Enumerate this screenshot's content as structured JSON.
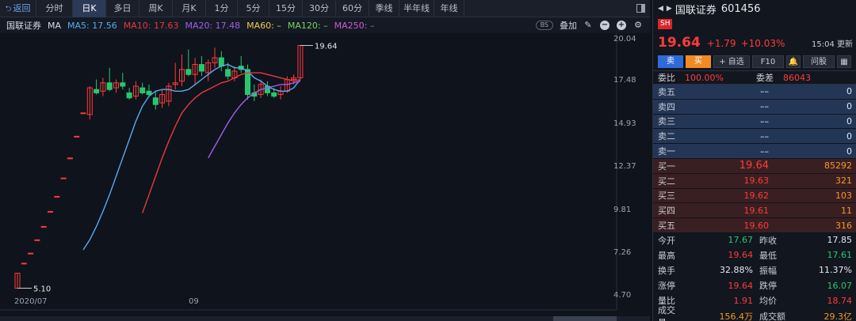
{
  "tabs": {
    "back": "返回",
    "items": [
      "分时",
      "日K",
      "多日",
      "周K",
      "月K",
      "1分",
      "5分",
      "15分",
      "30分",
      "60分",
      "季线",
      "半年线",
      "年线"
    ],
    "active": "日K"
  },
  "header": {
    "stock_name": "国联证券",
    "ma_label": "MA",
    "ma5": "MA5: 17.56",
    "ma10": "MA10: 17.63",
    "ma20": "MA20: 17.48",
    "ma60": "MA60: –",
    "ma120": "MA120: –",
    "ma250": "MA250: –",
    "bs": "BS",
    "overlay": "叠加"
  },
  "colors": {
    "up": "#ff3b3b",
    "down": "#28c76f",
    "ma5": "#5aa9f0",
    "ma10": "#e8393c",
    "ma20": "#a45ee8",
    "ma60": "#f2c94c",
    "ma120": "#7bd35a",
    "ma250": "#d05ad0"
  },
  "chart_data": {
    "type": "candlestick",
    "ylim": [
      4.7,
      20.04
    ],
    "y_ticks": [
      "20.04",
      "17.48",
      "14.93",
      "12.37",
      "9.81",
      "7.26",
      "4.70"
    ],
    "x_labels": [
      "2020/07",
      "09"
    ],
    "high_label": "19.64",
    "low_label": "5.10",
    "candles": [
      {
        "o": 5.1,
        "h": 6.0,
        "l": 5.1,
        "c": 6.0
      },
      {
        "o": 6.6,
        "h": 6.6,
        "l": 6.6,
        "c": 6.6
      },
      {
        "o": 7.2,
        "h": 7.2,
        "l": 7.2,
        "c": 7.2
      },
      {
        "o": 8.0,
        "h": 8.0,
        "l": 8.0,
        "c": 8.0
      },
      {
        "o": 8.8,
        "h": 8.8,
        "l": 8.8,
        "c": 8.8
      },
      {
        "o": 9.7,
        "h": 9.7,
        "l": 9.7,
        "c": 9.7
      },
      {
        "o": 10.6,
        "h": 10.6,
        "l": 10.6,
        "c": 10.6
      },
      {
        "o": 11.7,
        "h": 11.7,
        "l": 11.7,
        "c": 11.7
      },
      {
        "o": 12.9,
        "h": 12.9,
        "l": 12.9,
        "c": 12.9
      },
      {
        "o": 14.2,
        "h": 14.2,
        "l": 14.2,
        "c": 14.2
      },
      {
        "o": 15.6,
        "h": 15.6,
        "l": 15.6,
        "c": 15.6
      },
      {
        "o": 15.5,
        "h": 17.2,
        "l": 15.2,
        "c": 17.1
      },
      {
        "o": 17.0,
        "h": 17.6,
        "l": 16.7,
        "c": 16.8
      },
      {
        "o": 16.9,
        "h": 17.7,
        "l": 16.6,
        "c": 17.4
      },
      {
        "o": 17.4,
        "h": 18.3,
        "l": 16.9,
        "c": 17.0
      },
      {
        "o": 17.1,
        "h": 17.6,
        "l": 16.8,
        "c": 17.4
      },
      {
        "o": 17.4,
        "h": 18.0,
        "l": 17.0,
        "c": 17.2
      },
      {
        "o": 16.8,
        "h": 17.1,
        "l": 16.4,
        "c": 16.5
      },
      {
        "o": 16.6,
        "h": 17.5,
        "l": 16.4,
        "c": 17.2
      },
      {
        "o": 17.1,
        "h": 17.4,
        "l": 16.7,
        "c": 16.8
      },
      {
        "o": 16.9,
        "h": 17.3,
        "l": 16.6,
        "c": 16.7
      },
      {
        "o": 16.5,
        "h": 16.9,
        "l": 15.8,
        "c": 16.1
      },
      {
        "o": 16.2,
        "h": 17.0,
        "l": 15.9,
        "c": 16.7
      },
      {
        "o": 16.3,
        "h": 17.4,
        "l": 16.0,
        "c": 17.2
      },
      {
        "o": 17.3,
        "h": 18.6,
        "l": 17.0,
        "c": 17.4
      },
      {
        "o": 17.5,
        "h": 19.1,
        "l": 17.2,
        "c": 18.2
      },
      {
        "o": 18.2,
        "h": 19.4,
        "l": 17.8,
        "c": 17.9
      },
      {
        "o": 17.9,
        "h": 18.9,
        "l": 17.3,
        "c": 18.5
      },
      {
        "o": 18.5,
        "h": 19.0,
        "l": 17.8,
        "c": 18.1
      },
      {
        "o": 18.0,
        "h": 18.8,
        "l": 17.5,
        "c": 18.6
      },
      {
        "o": 18.6,
        "h": 19.5,
        "l": 18.3,
        "c": 18.9
      },
      {
        "o": 18.9,
        "h": 19.3,
        "l": 18.1,
        "c": 18.4
      },
      {
        "o": 18.2,
        "h": 18.6,
        "l": 17.6,
        "c": 17.8
      },
      {
        "o": 17.7,
        "h": 18.4,
        "l": 17.5,
        "c": 18.1
      },
      {
        "o": 18.4,
        "h": 19.0,
        "l": 18.0,
        "c": 18.2
      },
      {
        "o": 18.2,
        "h": 18.5,
        "l": 16.4,
        "c": 16.7
      },
      {
        "o": 16.8,
        "h": 17.3,
        "l": 16.3,
        "c": 16.6
      },
      {
        "o": 16.7,
        "h": 17.6,
        "l": 16.5,
        "c": 17.3
      },
      {
        "o": 17.2,
        "h": 17.5,
        "l": 16.6,
        "c": 16.8
      },
      {
        "o": 16.8,
        "h": 17.1,
        "l": 16.5,
        "c": 16.6
      },
      {
        "o": 16.7,
        "h": 17.2,
        "l": 16.4,
        "c": 16.9
      },
      {
        "o": 16.9,
        "h": 17.8,
        "l": 16.8,
        "c": 17.6
      },
      {
        "o": 17.6,
        "h": 17.9,
        "l": 17.3,
        "c": 17.7
      },
      {
        "o": 17.7,
        "h": 19.64,
        "l": 17.61,
        "c": 19.64
      }
    ],
    "series": [
      {
        "name": "MA5",
        "values": [
          null,
          null,
          null,
          null,
          null,
          null,
          null,
          null,
          null,
          null,
          7.4,
          8.0,
          8.8,
          9.7,
          10.7,
          11.8,
          12.9,
          14.0,
          15.1,
          16.0,
          16.6,
          16.9,
          17.0,
          17.0,
          16.9,
          16.9,
          17.0,
          17.3,
          17.6,
          17.9,
          18.2,
          18.4,
          18.5,
          18.3,
          18.3,
          18.1,
          17.7,
          17.5,
          17.2,
          17.0,
          16.9,
          16.9,
          17.1,
          17.6
        ]
      },
      {
        "name": "MA10",
        "values": [
          null,
          null,
          null,
          null,
          null,
          null,
          null,
          null,
          null,
          null,
          null,
          null,
          null,
          null,
          null,
          null,
          null,
          null,
          null,
          9.6,
          10.7,
          11.8,
          12.9,
          13.9,
          14.8,
          15.6,
          16.1,
          16.5,
          16.8,
          17.0,
          17.2,
          17.4,
          17.5,
          17.7,
          17.9,
          18.0,
          18.0,
          18.0,
          17.9,
          17.8,
          17.7,
          17.6,
          17.5,
          17.6
        ]
      },
      {
        "name": "MA20",
        "values": [
          null,
          null,
          null,
          null,
          null,
          null,
          null,
          null,
          null,
          null,
          null,
          null,
          null,
          null,
          null,
          null,
          null,
          null,
          null,
          null,
          null,
          null,
          null,
          null,
          null,
          null,
          null,
          null,
          null,
          12.9,
          13.6,
          14.3,
          15.0,
          15.6,
          16.1,
          16.5,
          16.8,
          17.0,
          17.1,
          17.2,
          17.3,
          17.3,
          17.4,
          17.5
        ]
      }
    ]
  },
  "quote": {
    "name": "国联证券",
    "code": "601456",
    "exchange": "SH",
    "price": "19.64",
    "change": "+1.79",
    "change_pct": "+10.03%",
    "time": "15:04 更新",
    "buttons": [
      "卖",
      "买",
      "+ 自选",
      "F10",
      "",
      "问股",
      ""
    ],
    "weibi_label": "委比",
    "weibi": "100.00%",
    "weicha_label": "委差",
    "weicha": "86043"
  },
  "order_book": {
    "sell": [
      {
        "label": "卖五",
        "price": "––",
        "vol": "0"
      },
      {
        "label": "卖四",
        "price": "––",
        "vol": "0"
      },
      {
        "label": "卖三",
        "price": "––",
        "vol": "0"
      },
      {
        "label": "卖二",
        "price": "––",
        "vol": "0"
      },
      {
        "label": "卖一",
        "price": "––",
        "vol": "0"
      }
    ],
    "buy": [
      {
        "label": "买一",
        "price": "19.64",
        "vol": "85292"
      },
      {
        "label": "买二",
        "price": "19.63",
        "vol": "321"
      },
      {
        "label": "买三",
        "price": "19.62",
        "vol": "103"
      },
      {
        "label": "买四",
        "price": "19.61",
        "vol": "11"
      },
      {
        "label": "买五",
        "price": "19.60",
        "vol": "316"
      }
    ]
  },
  "stats": [
    {
      "k1": "今开",
      "v1": "17.67",
      "c1": "green",
      "k2": "昨收",
      "v2": "17.85",
      "c2": "white"
    },
    {
      "k1": "最高",
      "v1": "19.64",
      "c1": "red",
      "k2": "最低",
      "v2": "17.61",
      "c2": "green"
    },
    {
      "k1": "换手",
      "v1": "32.88%",
      "c1": "white",
      "k2": "振幅",
      "v2": "11.37%",
      "c2": "white"
    },
    {
      "k1": "涨停",
      "v1": "19.64",
      "c1": "red",
      "k2": "跌停",
      "v2": "16.07",
      "c2": "green"
    },
    {
      "k1": "量比",
      "v1": "1.91",
      "c1": "red",
      "k2": "均价",
      "v2": "18.74",
      "c2": "red"
    },
    {
      "k1": "成交量",
      "v1": "156.4万",
      "c1": "orange",
      "k2": "成交额",
      "v2": "29.3亿",
      "c2": "orange"
    }
  ]
}
